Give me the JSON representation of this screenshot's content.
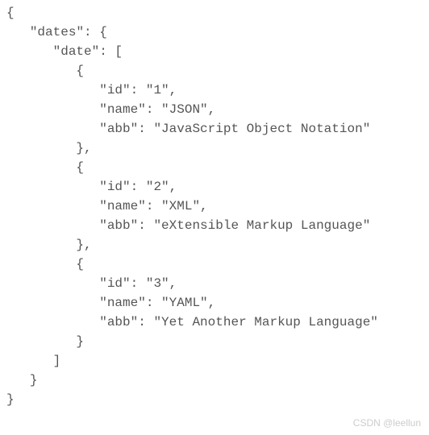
{
  "code": {
    "root_key": "dates",
    "array_key": "date",
    "items": [
      {
        "id_key": "id",
        "id_val": "1",
        "name_key": "name",
        "name_val": "JSON",
        "abb_key": "abb",
        "abb_val": "JavaScript Object Notation"
      },
      {
        "id_key": "id",
        "id_val": "2",
        "name_key": "name",
        "name_val": "XML",
        "abb_key": "abb",
        "abb_val": "eXtensible Markup Language"
      },
      {
        "id_key": "id",
        "id_val": "3",
        "name_key": "name",
        "name_val": "YAML",
        "abb_key": "abb",
        "abb_val": "Yet Another Markup Language"
      }
    ]
  },
  "watermark": "CSDN @leellun"
}
